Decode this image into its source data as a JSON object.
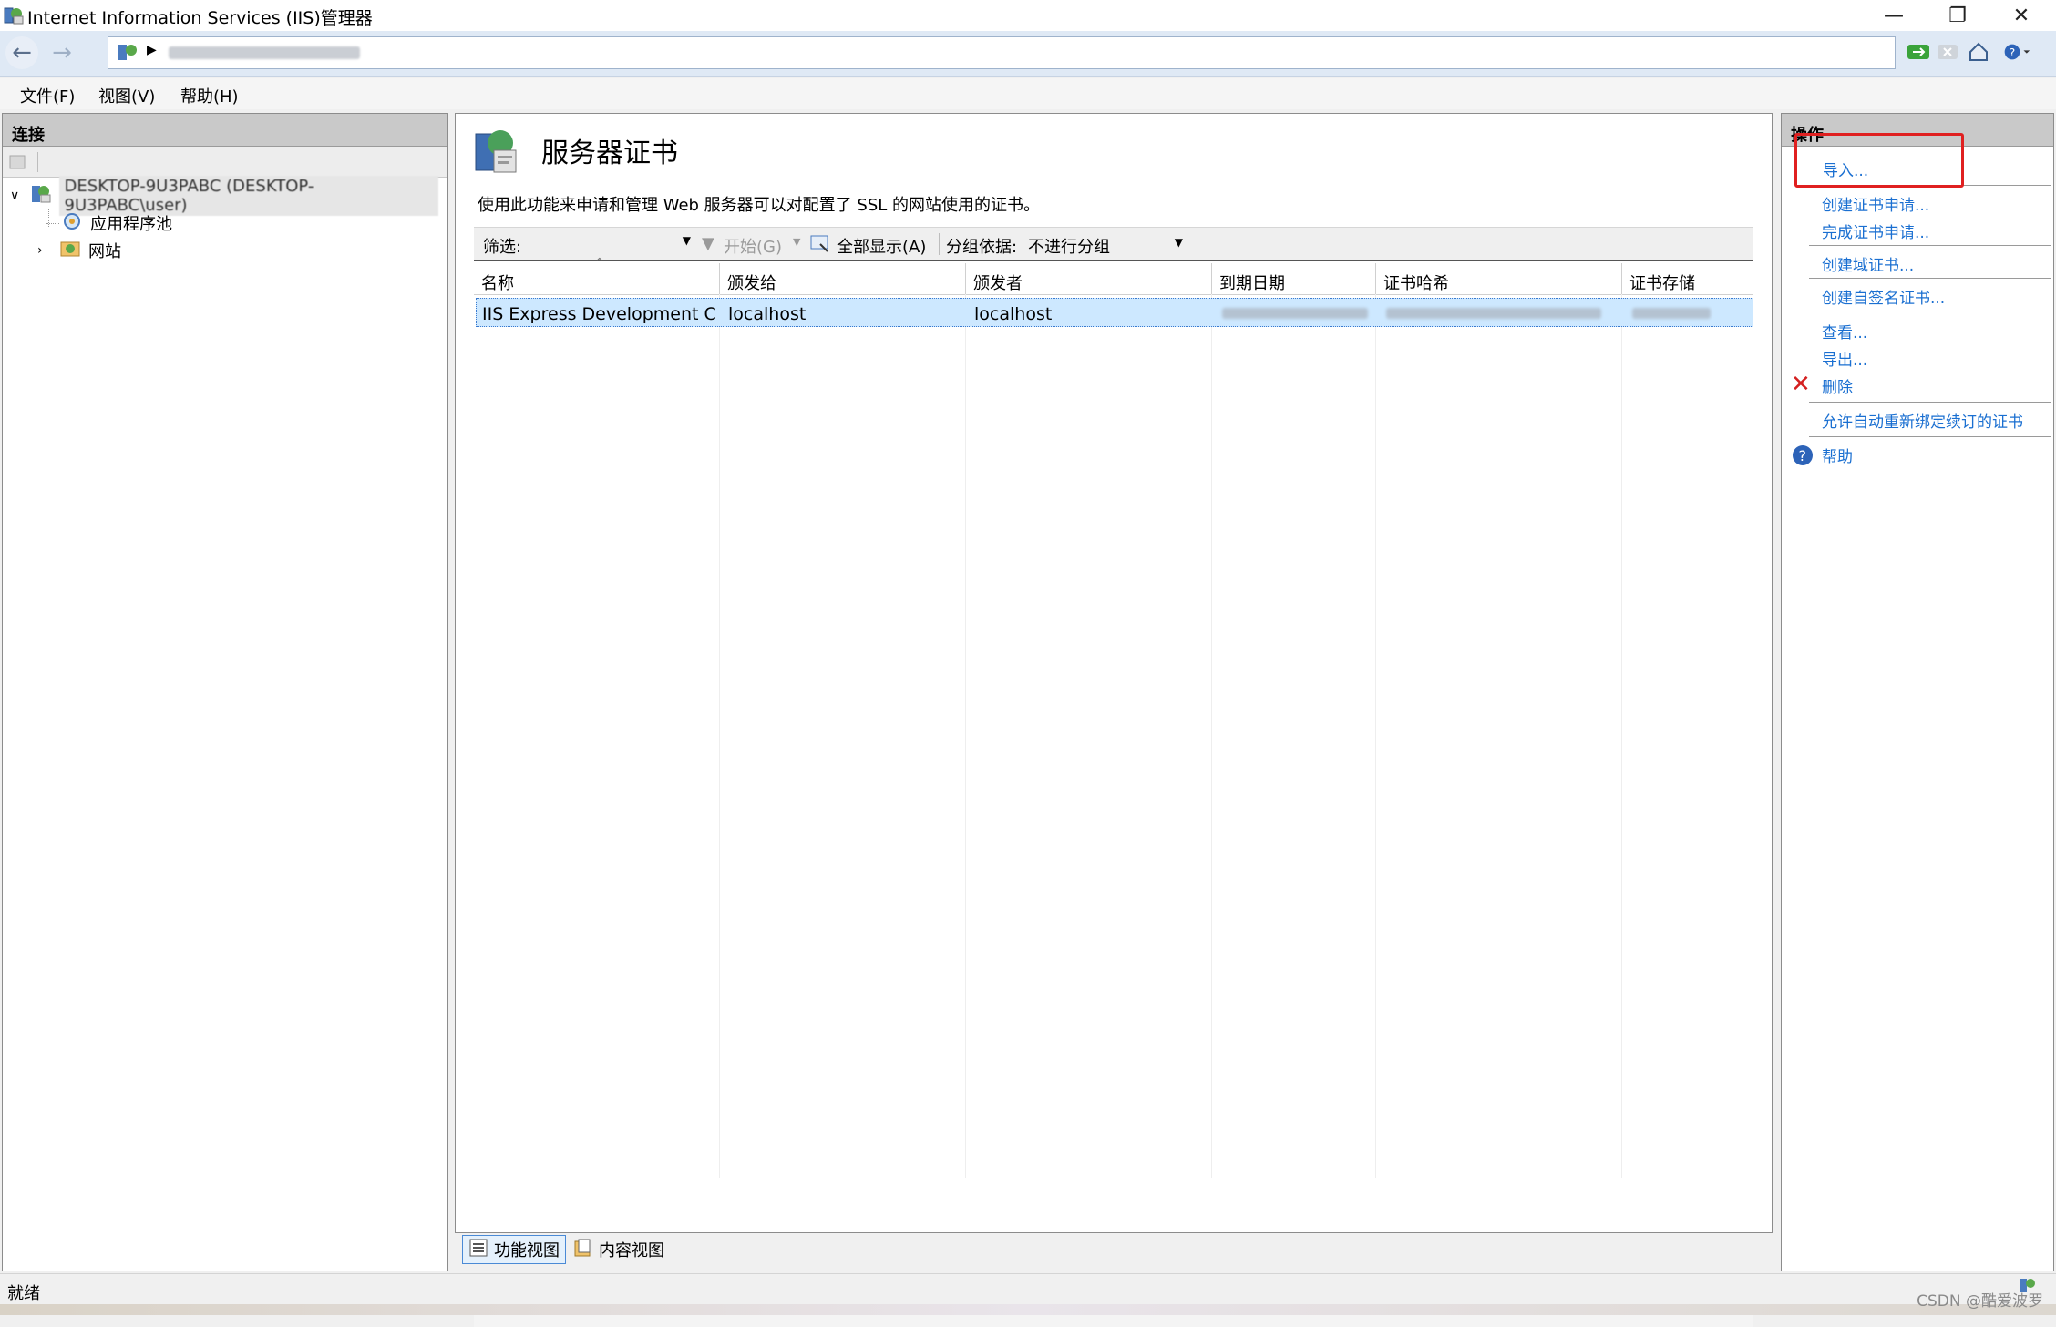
{
  "window": {
    "title": "Internet Information Services (IIS)管理器",
    "controls": [
      "minimize",
      "restore",
      "close"
    ]
  },
  "address_bar": {
    "value": "DESKTOP-9U3PABC"
  },
  "menu": {
    "items": [
      "文件(F)",
      "视图(V)",
      "帮助(H)"
    ]
  },
  "connections": {
    "header": "连接",
    "tree": [
      {
        "label": "DESKTOP-9U3PABC (DESKTOP-9U3PABC\\user)",
        "expanded": true,
        "icon": "server-icon"
      },
      {
        "label": "应用程序池",
        "icon": "app-pool-icon"
      },
      {
        "label": "网站",
        "icon": "sites-icon",
        "expanded": false
      }
    ]
  },
  "feature": {
    "title": "服务器证书",
    "description": "使用此功能来申请和管理 Web 服务器可以对配置了 SSL 的网站使用的证书。",
    "filter": {
      "label": "筛选:",
      "value": "",
      "start_label": "开始(G)",
      "show_all_label": "全部显示(A)",
      "group_label": "分组依据:",
      "group_value": "不进行分组"
    },
    "columns": [
      "名称",
      "颁发给",
      "颁发者",
      "到期日期",
      "证书哈希",
      "证书存储"
    ],
    "rows": [
      {
        "name": "IIS Express Development C...",
        "issued_to": "localhost",
        "issued_by": "localhost",
        "selected": true
      }
    ]
  },
  "view_tabs": [
    {
      "label": "功能视图",
      "active": true
    },
    {
      "label": "内容视图",
      "active": false
    }
  ],
  "actions": {
    "header": "操作",
    "items": [
      {
        "label": "导入...",
        "highlighted": true
      },
      {
        "label": "创建证书申请..."
      },
      {
        "label": "完成证书申请..."
      },
      {
        "label": "创建域证书..."
      },
      {
        "label": "创建自签名证书..."
      },
      {
        "label": "查看..."
      },
      {
        "label": "导出..."
      },
      {
        "label": "删除",
        "icon": "delete-icon"
      },
      {
        "label": "允许自动重新绑定续订的证书"
      },
      {
        "label": "帮助",
        "icon": "help-icon"
      }
    ]
  },
  "status": {
    "text": "就绪"
  },
  "watermark": "CSDN @酷爱波罗",
  "colors": {
    "accent_link": "#1a6fd1",
    "selection": "#cde8ff",
    "highlight_box": "#e02020"
  }
}
